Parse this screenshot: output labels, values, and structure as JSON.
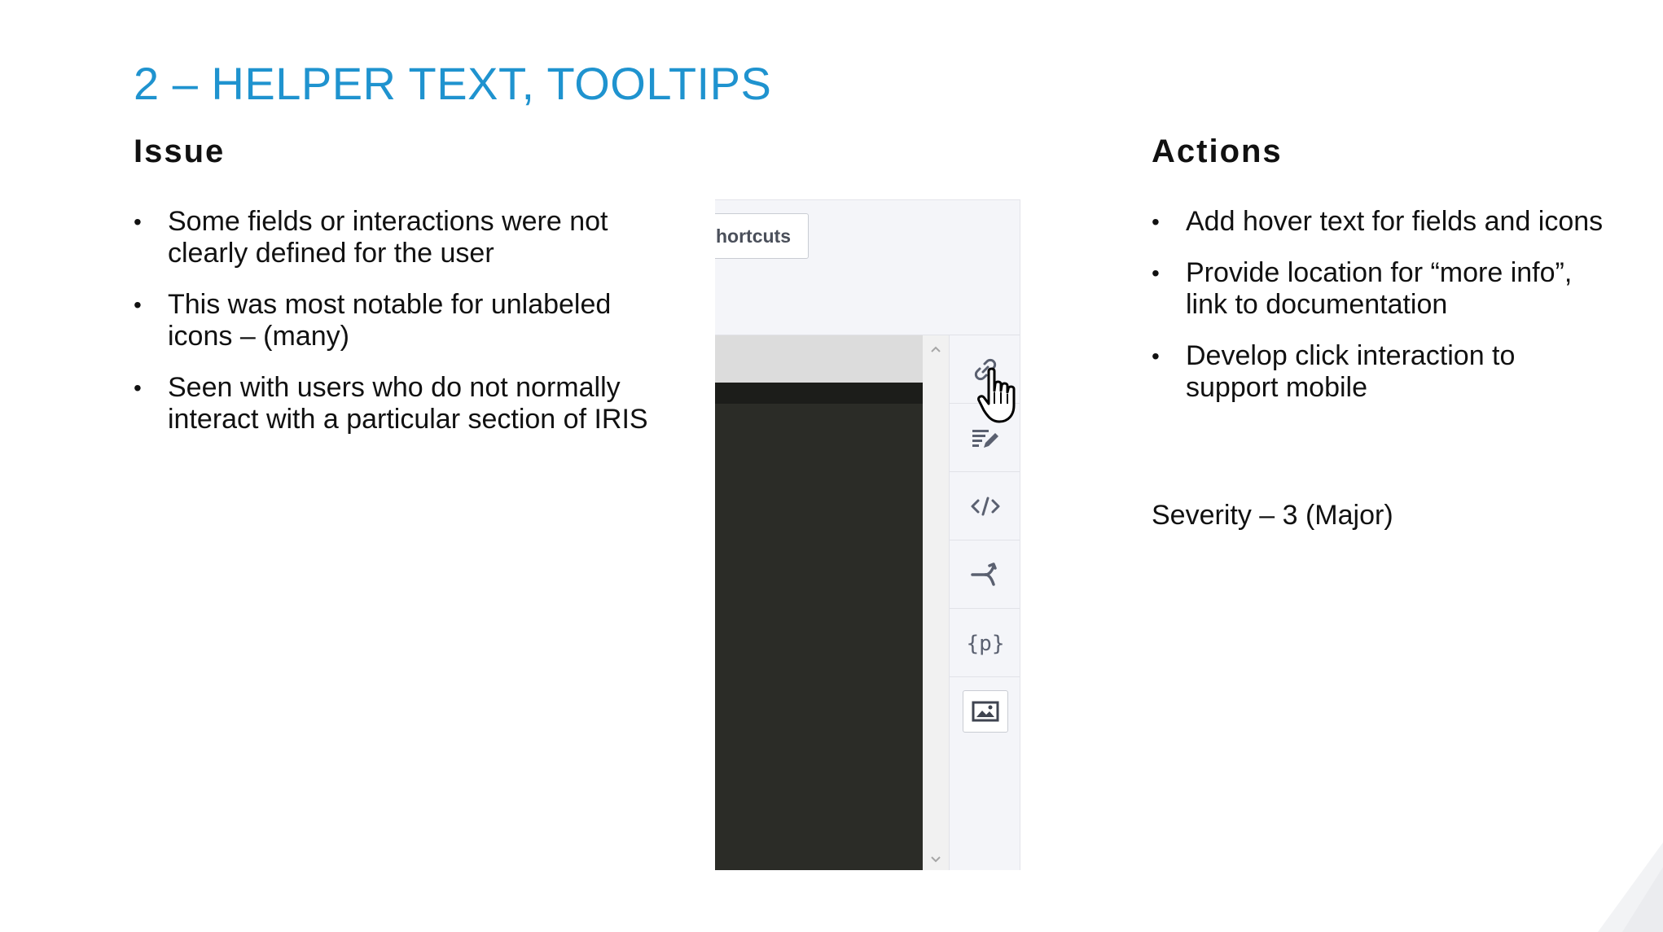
{
  "title": "2 – HELPER TEXT, TOOLTIPS",
  "issue": {
    "heading": "Issue",
    "bullets": [
      "Some fields or interactions were not clearly defined for the user",
      "This was most notable for unlabeled icons – (many)",
      "Seen with users who do not normally interact with a particular section of IRIS"
    ]
  },
  "actions": {
    "heading": "Actions",
    "bullets": [
      "Add hover text for fields and icons",
      "Provide location for “more info”, link to documentation",
      "Develop click interaction to support mobile"
    ],
    "severity": "Severity – 3 (Major)"
  },
  "screenshot": {
    "shortcuts_label": "hortcuts",
    "icons": [
      "link-icon",
      "edit-text-icon",
      "code-icon",
      "merge-icon",
      "parameter-icon",
      "image-icon"
    ],
    "icon_labels": {
      "parameter": "{p}"
    },
    "cursor": "hand-pointer-cursor"
  },
  "colors": {
    "title": "#1f93cf",
    "icon": "#5a6070",
    "editor_background": "#2b2c27"
  }
}
